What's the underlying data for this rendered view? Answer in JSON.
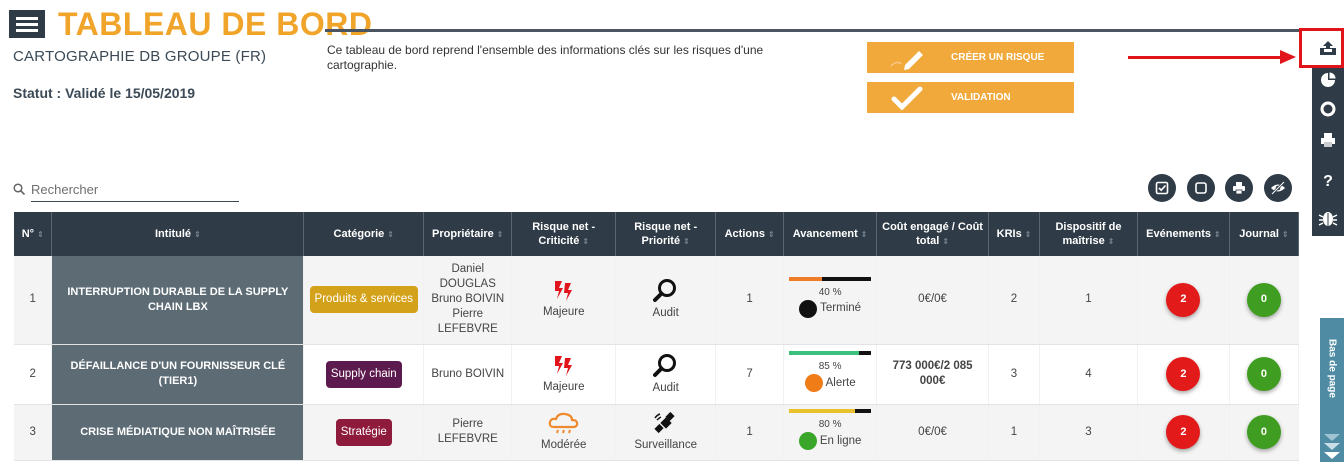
{
  "header": {
    "title": "TABLEAU DE BORD",
    "cartography": "CARTOGRAPHIE DB GROUPE (FR)",
    "status": "Statut : Validé le 15/05/2019",
    "description": "Ce tableau de bord reprend l'ensemble des informations clés sur les risques d'une cartographie."
  },
  "actions": {
    "create_label": "CRÉER UN RISQUE",
    "validate_label": "VALIDATION"
  },
  "colors": {
    "accent": "#f0a93a",
    "dark": "#2f3b46",
    "intitule_bg": "#5c6b74",
    "annotation": "#e1141b"
  },
  "right_rail": {
    "items": [
      "export-icon",
      "pie-chart-icon",
      "lifebuoy-icon",
      "printer-icon",
      "help-icon",
      "bug-icon"
    ],
    "help_glyph": "?"
  },
  "side_tab": {
    "label": "Bas de page"
  },
  "search": {
    "placeholder": "Rechercher"
  },
  "toolbar": [
    "check-square-icon",
    "square-icon",
    "print-icon",
    "hide-icon"
  ],
  "table": {
    "columns": [
      "N°",
      "Intitulé",
      "Catégorie",
      "Propriétaire",
      "Risque net - Criticité",
      "Risque net - Priorité",
      "Actions",
      "Avancement",
      "Coût engagé / Coût total",
      "KRIs",
      "Dispositif de maîtrise",
      "Evénements",
      "Journal"
    ],
    "rows": [
      {
        "num": "1",
        "title": "INTERRUPTION DURABLE DE LA SUPPLY CHAIN LBX",
        "category": "Produits & services",
        "category_color": "#d4a21a",
        "owner": "Daniel DOUGLAS Bruno BOIVIN Pierre LEFEBVRE",
        "criticity": "Majeure",
        "criticity_icon": "lightning-icon",
        "priority": "Audit",
        "priority_icon": "magnifier-icon",
        "actions": "1",
        "progress": 40,
        "progress_label": "40 %",
        "progress_color": "#f07c27",
        "state": "Terminé",
        "state_color": "#111111",
        "cost": "0€/0€",
        "kris": "2",
        "controls": "1",
        "events": "2",
        "journal": "0"
      },
      {
        "num": "2",
        "title": "DÉFAILLANCE D'UN FOURNISSEUR CLÉ (TIER1)",
        "category": "Supply chain",
        "category_color": "#5d1a4e",
        "owner": "Bruno BOIVIN",
        "criticity": "Majeure",
        "criticity_icon": "lightning-icon",
        "priority": "Audit",
        "priority_icon": "magnifier-icon",
        "actions": "7",
        "progress": 85,
        "progress_label": "85 %",
        "progress_color": "#3cc07e",
        "state": "Alerte",
        "state_color": "#f07c18",
        "cost": "773 000€/2 085 000€",
        "kris": "3",
        "controls": "4",
        "events": "2",
        "journal": "0"
      },
      {
        "num": "3",
        "title": "CRISE MÉDIATIQUE NON MAÎTRISÉE",
        "category": "Stratégie",
        "category_color": "#8e1a3c",
        "owner": "Pierre LEFEBVRE",
        "criticity": "Modérée",
        "criticity_icon": "storm-cloud-icon",
        "priority": "Surveillance",
        "priority_icon": "satellite-icon",
        "actions": "1",
        "progress": 80,
        "progress_label": "80 %",
        "progress_color": "#e9c12d",
        "state": "En ligne",
        "state_color": "#3aa629",
        "cost": "0€/0€",
        "kris": "1",
        "controls": "3",
        "events": "2",
        "journal": "0"
      }
    ]
  }
}
